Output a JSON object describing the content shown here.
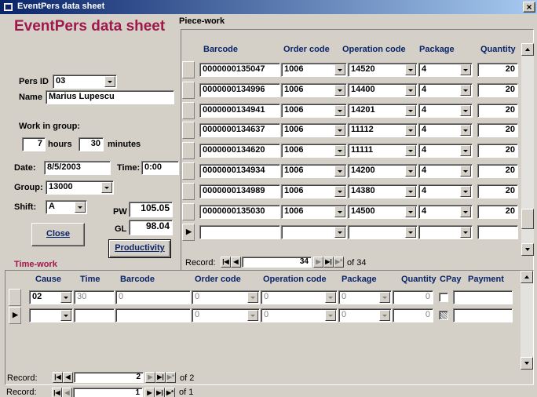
{
  "window": {
    "title": "EventPers data sheet",
    "close": "×"
  },
  "header": {
    "title": "EventPers data sheet",
    "title_color": "#a0174c"
  },
  "pers": {
    "id_label": "Pers ID",
    "id_value": "03",
    "name_label": "Name",
    "name_value": "Marius Lupescu"
  },
  "work_group": {
    "label": "Work in group:",
    "hours_value": "7",
    "hours_label": "hours",
    "minutes_value": "30",
    "minutes_label": "minutes"
  },
  "date": {
    "label": "Date:",
    "value": "8/5/2003"
  },
  "time": {
    "label": "Time:",
    "value": "0:00"
  },
  "group": {
    "label": "Group:",
    "value": "13000"
  },
  "shift": {
    "label": "Shift:",
    "value": "A"
  },
  "pw": {
    "label": "PW",
    "value": "105.05"
  },
  "gl": {
    "label": "GL",
    "value": "98.04"
  },
  "buttons": {
    "close": "Close",
    "productivity": "Productivity"
  },
  "piece_work": {
    "section_label": "Piece-work",
    "columns": [
      "Barcode",
      "Order code",
      "Operation code",
      "Package",
      "Quantity"
    ],
    "rows": [
      {
        "barcode": "0000000135047",
        "order": "1006",
        "operation": "14520",
        "package": "4",
        "quantity": "20"
      },
      {
        "barcode": "0000000134996",
        "order": "1006",
        "operation": "14400",
        "package": "4",
        "quantity": "20"
      },
      {
        "barcode": "0000000134941",
        "order": "1006",
        "operation": "14201",
        "package": "4",
        "quantity": "20"
      },
      {
        "barcode": "0000000134637",
        "order": "1006",
        "operation": "11112",
        "package": "4",
        "quantity": "20"
      },
      {
        "barcode": "0000000134620",
        "order": "1006",
        "operation": "11111",
        "package": "4",
        "quantity": "20"
      },
      {
        "barcode": "0000000134934",
        "order": "1006",
        "operation": "14200",
        "package": "4",
        "quantity": "20"
      },
      {
        "barcode": "0000000134989",
        "order": "1006",
        "operation": "14380",
        "package": "4",
        "quantity": "20"
      },
      {
        "barcode": "0000000135030",
        "order": "1006",
        "operation": "14500",
        "package": "4",
        "quantity": "20"
      }
    ],
    "record_label": "Record:",
    "record_value": "34",
    "record_of": "of 34"
  },
  "time_work": {
    "section_label": "Time-work",
    "columns": [
      "Cause",
      "Time",
      "Barcode",
      "Order code",
      "Operation code",
      "Package",
      "Quantity",
      "CPay",
      "Payment"
    ],
    "row": {
      "cause": "02",
      "time": "30",
      "barcode": "0",
      "order": "0",
      "operation": "0",
      "package": "0",
      "quantity": "0"
    },
    "new_row": {
      "order": "0",
      "operation": "0",
      "package": "0",
      "quantity": "0"
    },
    "record_label": "Record:",
    "record_value": "2",
    "record_of": "of 2"
  },
  "main_nav": {
    "record_label": "Record:",
    "record_value": "1",
    "record_of": "of 1"
  },
  "nav_icons": {
    "first": "first-record-icon",
    "prev": "prev-record-icon",
    "next": "next-record-icon",
    "last": "last-record-icon",
    "new": "new-record-icon"
  }
}
